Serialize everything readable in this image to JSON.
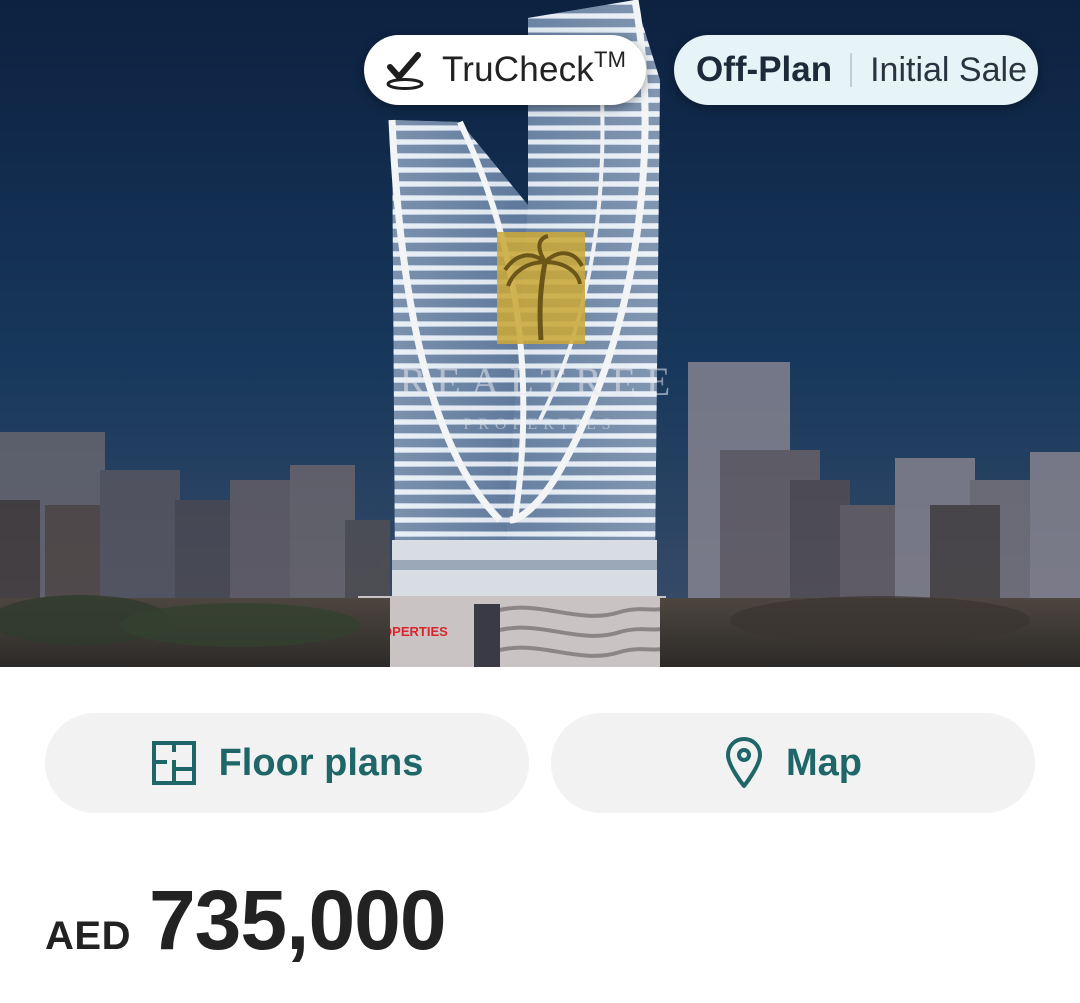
{
  "hero": {
    "image_alt": "Rendering of a twin residential tower at night",
    "watermark_title": "REALTREE",
    "watermark_subtitle": "PROPERTIES",
    "building_sign": "PROPERTIES"
  },
  "badges": {
    "trucheck_label": "TruCheck",
    "trucheck_mark": "TM",
    "trucheck_icon": "check-badge-icon",
    "status_primary": "Off-Plan",
    "status_secondary": "Initial Sale"
  },
  "actions": {
    "floor_plans_label": "Floor plans",
    "floor_plans_icon": "floor-plan-icon",
    "map_label": "Map",
    "map_icon": "map-pin-icon"
  },
  "price": {
    "currency": "AED",
    "amount": "735,000"
  },
  "colors": {
    "accent": "#1f6669",
    "button_bg": "#f2f2f2",
    "status_pill_bg": "#e6f3f7",
    "hero_sky": "#0f2644"
  }
}
